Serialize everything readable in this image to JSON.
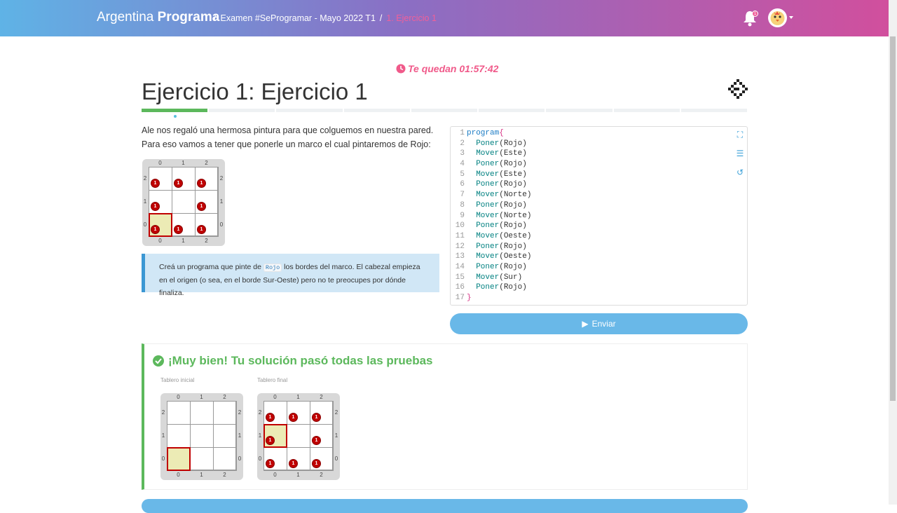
{
  "header": {
    "brand_light": "Argentina",
    "brand_bold": "Programa",
    "breadcrumb": [
      "Examen #SeProgramar - Mayo 2022 T1",
      "1. Ejercicio 1"
    ],
    "notification_count": "1"
  },
  "timer": {
    "text": "Te quedan 01:57:42"
  },
  "exercise": {
    "title": "Ejercicio 1: Ejercicio 1",
    "progress": {
      "total_steps": 9,
      "completed_steps": 1
    },
    "description": "Ale nos regaló una hermosa pintura para que colguemos en nuestra pared. Para eso vamos a tener que ponerle un marco el cual pintaremos de Rojo:",
    "hint_before": "Creá un programa que pinte de ",
    "hint_code": "Rojo",
    "hint_after": " los bordes del marco. El cabezal empieza en el origen (o sea, en el borde Sur-Oeste) pero no te preocupes por dónde finaliza."
  },
  "board_labels": {
    "cols": [
      "0",
      "1",
      "2"
    ],
    "rows": [
      "2",
      "1",
      "0"
    ],
    "ball_count": "1"
  },
  "editor": {
    "line_numbers": [
      "1",
      "2",
      "3",
      "4",
      "5",
      "6",
      "7",
      "8",
      "9",
      "10",
      "11",
      "12",
      "13",
      "14",
      "15",
      "16",
      "17"
    ],
    "lines": [
      {
        "fn": "program",
        "arg": "{"
      },
      {
        "fn": "Poner",
        "arg": "(Rojo)"
      },
      {
        "fn": "Mover",
        "arg": "(Este)"
      },
      {
        "fn": "Poner",
        "arg": "(Rojo)"
      },
      {
        "fn": "Mover",
        "arg": "(Este)"
      },
      {
        "fn": "Poner",
        "arg": "(Rojo)"
      },
      {
        "fn": "Mover",
        "arg": "(Norte)"
      },
      {
        "fn": "Poner",
        "arg": "(Rojo)"
      },
      {
        "fn": "Mover",
        "arg": "(Norte)"
      },
      {
        "fn": "Poner",
        "arg": "(Rojo)"
      },
      {
        "fn": "Mover",
        "arg": "(Oeste)"
      },
      {
        "fn": "Poner",
        "arg": "(Rojo)"
      },
      {
        "fn": "Mover",
        "arg": "(Oeste)"
      },
      {
        "fn": "Poner",
        "arg": "(Rojo)"
      },
      {
        "fn": "Mover",
        "arg": "(Sur)"
      },
      {
        "fn": "Poner",
        "arg": "(Rojo)"
      },
      {
        "fn": "}",
        "arg": ""
      }
    ],
    "submit_label": "Enviar"
  },
  "result": {
    "title": "¡Muy bien! Tu solución pasó todas las pruebas",
    "initial_caption": "Tablero inicial",
    "final_caption": "Tablero final"
  },
  "colors": {
    "accent": "#5cb85c",
    "primary": "#69b8e8",
    "timer": "#f05a8a",
    "ball": "#c00000"
  }
}
